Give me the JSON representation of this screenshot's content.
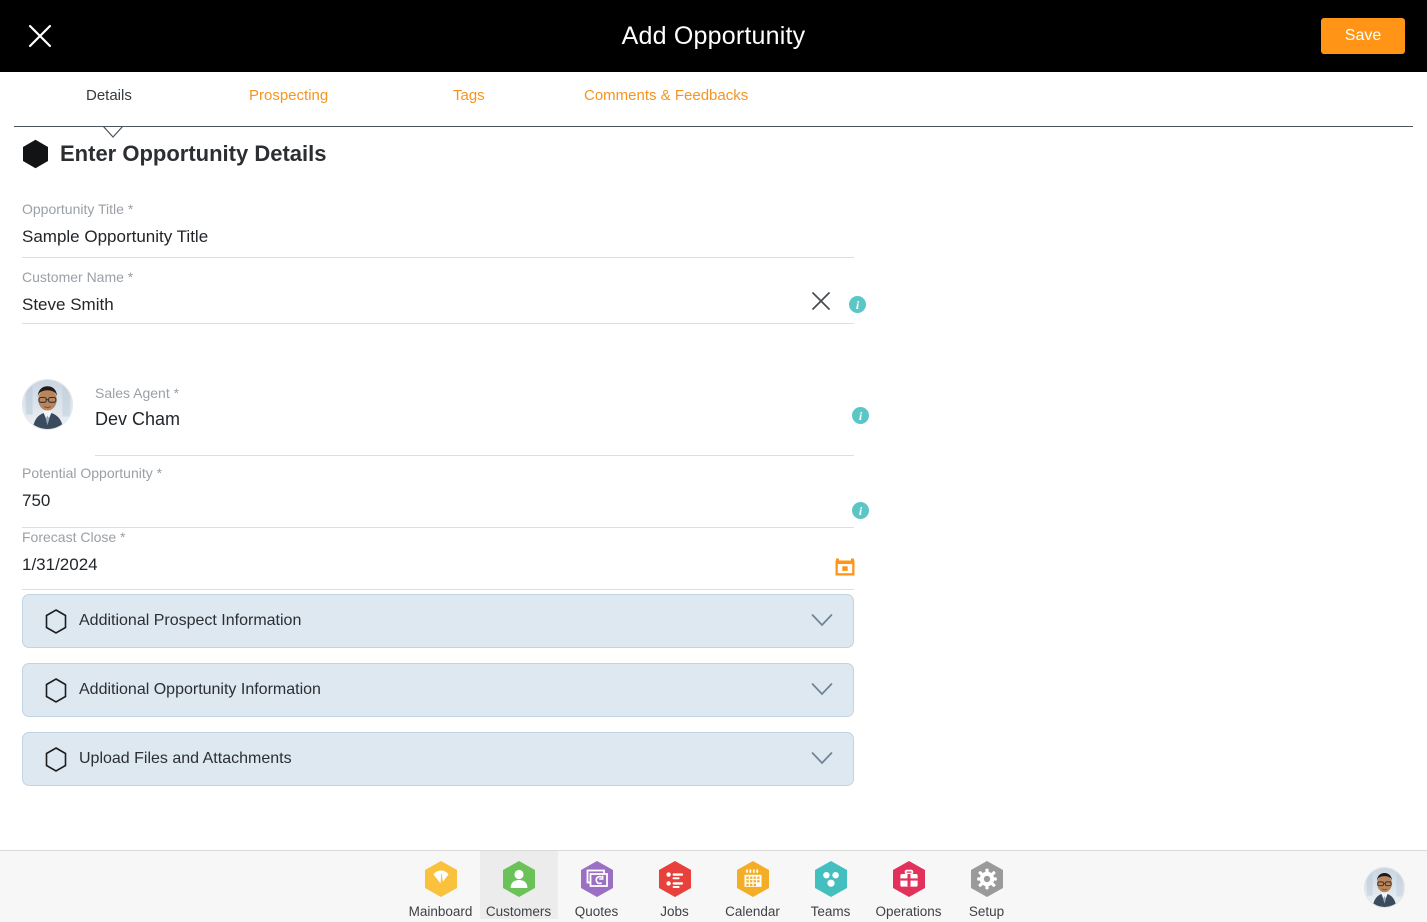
{
  "header": {
    "title": "Add Opportunity",
    "close_icon": "close-icon",
    "save_label": "Save",
    "background": "#000000",
    "save_color": "#ff9416"
  },
  "tabs": {
    "active_index": 0,
    "items": [
      {
        "label": "Details"
      },
      {
        "label": "Prospecting"
      },
      {
        "label": "Tags"
      },
      {
        "label": "Comments & Feedbacks"
      }
    ],
    "active_color": "#333a40",
    "inactive_color": "#f7941e"
  },
  "section": {
    "icon": "hexagon-icon",
    "title": "Enter Opportunity Details"
  },
  "form": {
    "fields": [
      {
        "label": "Opportunity Title *",
        "value": "Sample Opportunity Title"
      },
      {
        "label": "Customer Name *",
        "value": "Steve Smith",
        "clear_icon": "close-icon",
        "info_icon": "info-icon"
      },
      {
        "label": "Sales Agent *",
        "value": "Dev Cham",
        "avatar": "avatar",
        "info_icon": "info-icon"
      },
      {
        "label": "Potential Opportunity *",
        "value": "750",
        "info_icon": "info-icon"
      },
      {
        "label": "Forecast Close *",
        "value": "1/31/2024",
        "calendar_icon": "calendar-icon"
      }
    ],
    "info_color": "#5bc6c6",
    "calendar_color": "#ff9416"
  },
  "accordions": [
    {
      "label": "Additional Prospect Information",
      "icon": "hexagon-outline-icon",
      "chevron": "chevron-down-icon",
      "expanded": false
    },
    {
      "label": "Additional Opportunity Information",
      "icon": "hexagon-outline-icon",
      "chevron": "chevron-down-icon",
      "expanded": false
    },
    {
      "label": "Upload Files and Attachments",
      "icon": "hexagon-outline-icon",
      "chevron": "chevron-down-icon",
      "expanded": false
    }
  ],
  "bottom_nav": {
    "active_index": 1,
    "items": [
      {
        "label": "Mainboard",
        "icon": "mainboard-icon",
        "color": "#f9c13c"
      },
      {
        "label": "Customers",
        "icon": "customers-icon",
        "color": "#6ac259"
      },
      {
        "label": "Quotes",
        "icon": "quotes-icon",
        "color": "#9b6fc4"
      },
      {
        "label": "Jobs",
        "icon": "jobs-icon",
        "color": "#e8403a"
      },
      {
        "label": "Calendar",
        "icon": "calendar-icon",
        "color": "#f4ad27"
      },
      {
        "label": "Teams",
        "icon": "teams-icon",
        "color": "#43bfc0"
      },
      {
        "label": "Operations",
        "icon": "operations-icon",
        "color": "#e2325b"
      },
      {
        "label": "Setup",
        "icon": "setup-icon",
        "color": "#9a9a9a"
      }
    ],
    "user_avatar": "user-avatar"
  }
}
